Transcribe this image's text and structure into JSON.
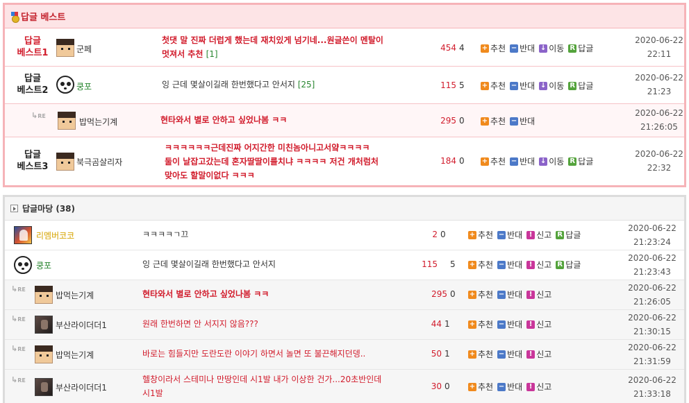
{
  "best": {
    "title": "답글 베스트",
    "rows": [
      {
        "rank": [
          "답글",
          "베스트1"
        ],
        "nick": "군페",
        "post": "첫댓 말 진짜 더럽게 했는데 재치있게 넘기네...원글쓴이 멘탈이",
        "post2": "멋져서 추천",
        "comments": "[1]",
        "views": "454",
        "votes": "4",
        "date": "2020-06-22",
        "time": "22:11"
      },
      {
        "rank": [
          "답글",
          "베스트2"
        ],
        "nick": "쿵포",
        "post": "잉 근데 몇살이길래 한번했다고 안서지",
        "comments": "[25]",
        "views": "115",
        "votes": "5",
        "date": "2020-06-22",
        "time": "21:23"
      },
      {
        "re": "RE",
        "nick": "밥먹는기계",
        "post": "현타와서 별로 안하고 싶었나봄 ㅋㅋ",
        "views": "295",
        "votes": "0",
        "date": "2020-06-22",
        "time": "21:26:05"
      },
      {
        "rank": [
          "답글",
          "베스트3"
        ],
        "nick": "북극곰살리자",
        "post": "ㅋㅋㅋㅋㅋㅋ근데진짜 어지간한 미친놈아니고서얔ㅋㅋㅋㅋ",
        "post2": "둘이 날잡고갔는데 혼자딸딸이를치냐 ㅋㅋㅋㅋ 저건 개처럼처",
        "post3": "맞아도 할말이없다 ㅋㅋㅋ",
        "views": "184",
        "votes": "0",
        "date": "2020-06-22",
        "time": "22:32"
      }
    ]
  },
  "actions": {
    "recommend": "추천",
    "oppose": "반대",
    "move": "이동",
    "reply": "답글",
    "report": "신고"
  },
  "yard": {
    "title": "답글마당 (38)",
    "rows": [
      {
        "nick": "리멤버코코",
        "post": "ㅋㅋㅋㅋㄱ끄",
        "views": "2",
        "votes": "0",
        "date": "2020-06-22",
        "time": "21:23:24"
      },
      {
        "nick": "쿵포",
        "post": "잉 근데 몇살이길래 한번했다고 안서지",
        "views": "115",
        "votes": "5",
        "date": "2020-06-22",
        "time": "21:23:43"
      },
      {
        "re": "RE",
        "nick": "밥먹는기계",
        "post": "현타와서 별로 안하고 싶었나봄 ㅋㅋ",
        "views": "295",
        "votes": "0",
        "date": "2020-06-22",
        "time": "21:26:05"
      },
      {
        "re": "RE",
        "nick": "부산라이더더1",
        "post": "원래 한번하면 안 서지지 않음???",
        "views": "44",
        "votes": "1",
        "date": "2020-06-22",
        "time": "21:30:15"
      },
      {
        "re": "RE",
        "nick": "밥먹는기계",
        "post": "바로는 힘들지만 도란도란 이야기 하면서 놀면 또 불끈해지던뎅..",
        "views": "50",
        "votes": "1",
        "date": "2020-06-22",
        "time": "21:31:59"
      },
      {
        "re": "RE",
        "nick": "부산라이더더1",
        "post": "헬창이라서 스테미나 만땅인데 시1발 내가 이상한 건가...20초반인데",
        "post2": "시1발",
        "views": "30",
        "votes": "0",
        "date": "2020-06-22",
        "time": "21:33:18"
      }
    ]
  },
  "colors": {
    "accent": "#d11b2b",
    "best_border": "#f6b3b8",
    "best_header": "#fde4e6",
    "green": "#28862f"
  }
}
